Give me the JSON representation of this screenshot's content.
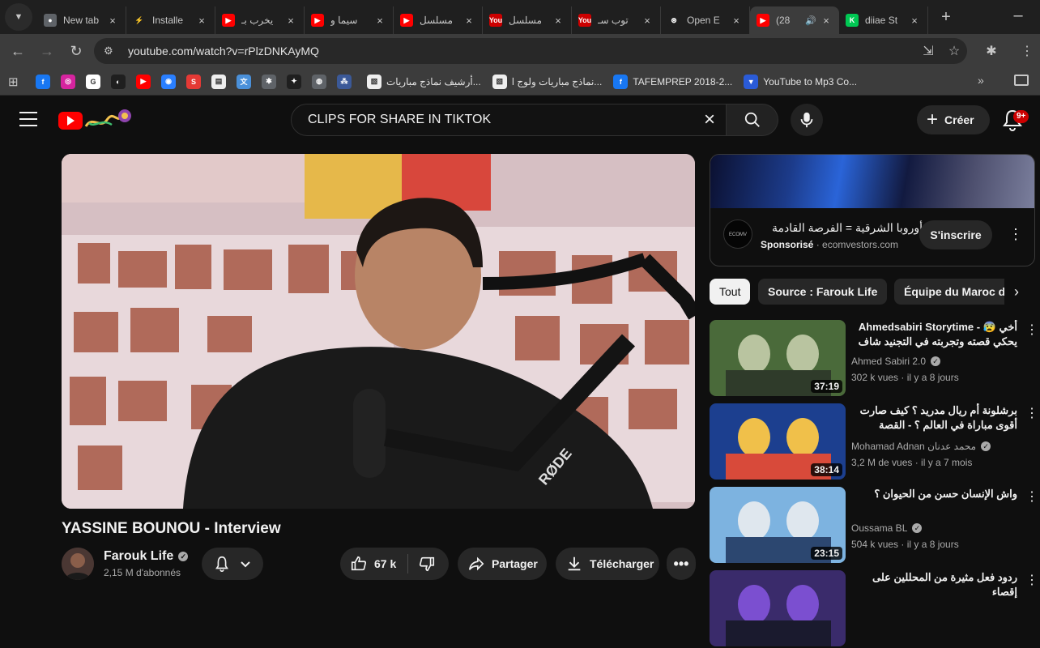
{
  "browser": {
    "tabs": [
      {
        "title": "New tab",
        "icon": "chrome-icon",
        "color": "#5f6368",
        "glyph": "●"
      },
      {
        "title": "Installe",
        "icon": "bolt-icon",
        "color": "#1f1f1f",
        "glyph": "⚡"
      },
      {
        "title": "يخرب بـ",
        "icon": "youtube-icon",
        "color": "#ff0000",
        "glyph": "▶"
      },
      {
        "title": "سيما و",
        "icon": "youtube-icon",
        "color": "#ff0000",
        "glyph": "▶"
      },
      {
        "title": "مسلسل",
        "icon": "youtube-icon",
        "color": "#ff0000",
        "glyph": "▶"
      },
      {
        "title": "مسلسل",
        "icon": "youtube-old-icon",
        "color": "#cc0000",
        "glyph": "You"
      },
      {
        "title": "توب سـ",
        "icon": "youtube-old-icon",
        "color": "#cc0000",
        "glyph": "You"
      },
      {
        "title": "Open E",
        "icon": "openai-icon",
        "color": "#1f1f1f",
        "glyph": "⊛"
      },
      {
        "title": "(28",
        "icon": "youtube-icon",
        "color": "#ff0000",
        "glyph": "▶",
        "active": true,
        "audio": "🔊"
      },
      {
        "title": "diiae St",
        "icon": "k-icon",
        "color": "#00c853",
        "glyph": "K"
      }
    ],
    "url": "youtube.com/watch?v=rPlzDNKAyMQ",
    "bookmarks_icons": [
      {
        "name": "facebook-icon",
        "color": "#1877f2",
        "glyph": "f"
      },
      {
        "name": "instagram-icon",
        "color": "#d6249f",
        "glyph": "◎"
      },
      {
        "name": "google-icon",
        "color": "#ffffff",
        "glyph": "G"
      },
      {
        "name": "link-icon",
        "color": "#1f1f1f",
        "glyph": "◐"
      },
      {
        "name": "youtube-icon",
        "color": "#ff0000",
        "glyph": "▶"
      },
      {
        "name": "globe-icon",
        "color": "#2a7fff",
        "glyph": "◉"
      },
      {
        "name": "s-icon",
        "color": "#e53935",
        "glyph": "S"
      },
      {
        "name": "page-icon",
        "color": "#eeeeee",
        "glyph": "▤"
      },
      {
        "name": "translate-icon",
        "color": "#4a90d9",
        "glyph": "文"
      },
      {
        "name": "puzzle-icon",
        "color": "#5f6368",
        "glyph": "✱"
      },
      {
        "name": "star-icon",
        "color": "#1f1f1f",
        "glyph": "✦"
      },
      {
        "name": "world-icon",
        "color": "#5f6368",
        "glyph": "◍"
      },
      {
        "name": "people-icon",
        "color": "#3b5998",
        "glyph": "⁂"
      }
    ],
    "bookmarks_labeled": [
      {
        "label": "أرشيف نماذج مباريات...",
        "icon": "bookmark-image-icon",
        "color": "#eeeeee",
        "glyph": "▧"
      },
      {
        "label": "نماذج مباريات ولوج ا...",
        "icon": "bookmark-image-icon",
        "color": "#eeeeee",
        "glyph": "▧"
      },
      {
        "label": "TAFEMPREP 2018-2...",
        "icon": "facebook-icon",
        "color": "#1877f2",
        "glyph": "f"
      },
      {
        "label": "YouTube to Mp3 Co...",
        "icon": "shield-icon",
        "color": "#2a5bd7",
        "glyph": "▼"
      }
    ]
  },
  "yt": {
    "search_query": "CLIPS FOR SHARE IN TIKTOK",
    "create_label": "Créer",
    "notif_badge": "9+",
    "video_title": "YASSINE BOUNOU - Interview",
    "channel_name": "Farouk Life",
    "channel_subs": "2,15 M d'abonnés",
    "likes": "67 k",
    "share_label": "Partager",
    "download_label": "Télécharger",
    "ad": {
      "title": "أوروبا الشرقية = الفرصة القادمة",
      "sponsored": "Sponsorisé",
      "domain": "ecomvestors.com",
      "subscribe_label": "S'inscrire"
    },
    "chips": [
      "Tout",
      "Source : Farouk Life",
      "Équipe du Maroc de"
    ],
    "recs": [
      {
        "title": "Ahmedsabiri Storytime - 😰 أخي يحكي قصته وتجربته في التجنيد شاف جنون",
        "channel": "Ahmed Sabiri 2.0",
        "meta": "302 k vues · il y a 8 jours",
        "duration": "37:19"
      },
      {
        "title": "برشلونة أم ريال مدريد ؟ كيف صارت أقوى مباراة في العالم ؟ - القصة الكاملة 🔥",
        "channel": "Mohamad Adnan محمد عدنان",
        "meta": "3,2 M de vues · il y a 7 mois",
        "duration": "38:14"
      },
      {
        "title": "واش الإنسان حسن من الحيوان ؟",
        "channel": "Oussama BL",
        "meta": "504 k vues · il y a 8 jours",
        "duration": "23:15"
      },
      {
        "title": "ردود فعل مثيرة من المحللين على إقصاء",
        "channel": "",
        "meta": "",
        "duration": ""
      }
    ]
  }
}
